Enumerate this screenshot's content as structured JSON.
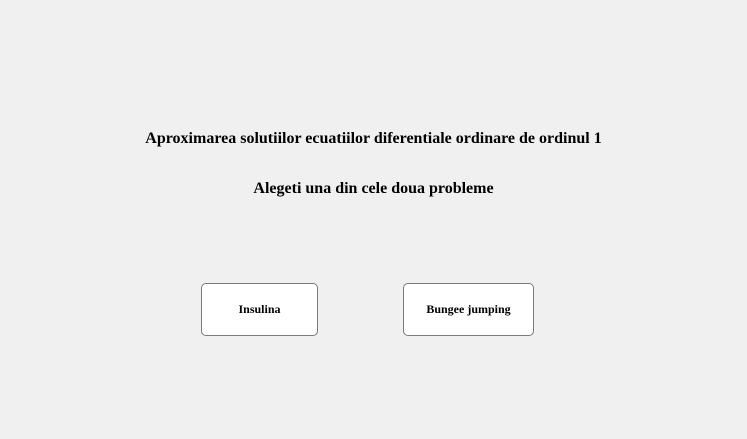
{
  "window": {
    "background": "#f0f0f0"
  },
  "main": {
    "title": "Aproximarea solutiilor ecuatiilor diferentiale ordinare de ordinul 1",
    "subtitle": "Alegeti una din cele doua probleme"
  },
  "buttons": {
    "insulina_label": "Insulina",
    "bungee_label": "Bungee jumping"
  }
}
